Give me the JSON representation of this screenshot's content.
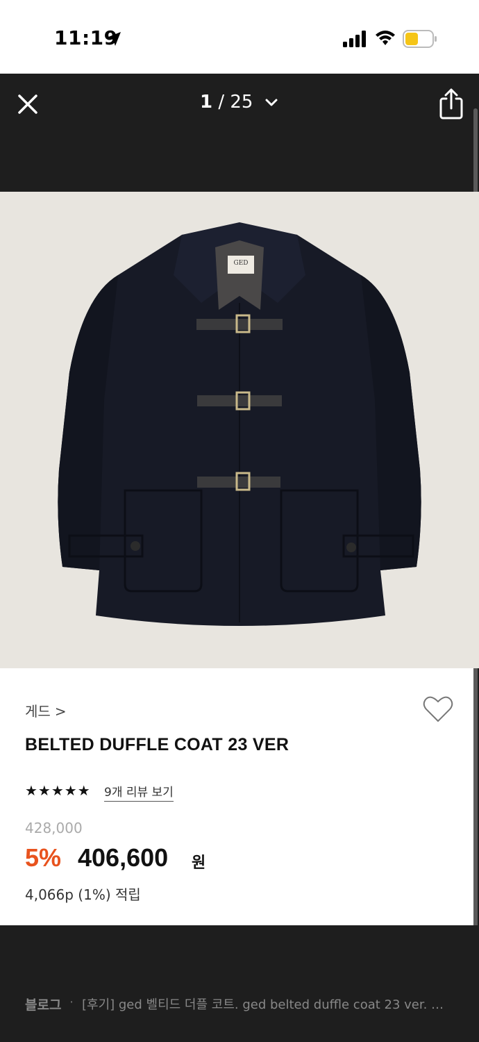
{
  "status_bar": {
    "time": "11:19",
    "icons": [
      "location-arrow-icon",
      "cellular-signal-icon",
      "wifi-icon",
      "battery-low-icon"
    ],
    "battery_color": "#f5c518"
  },
  "viewer": {
    "current": "1",
    "separator": "/",
    "total": "25",
    "close_icon": "close-icon",
    "dropdown_icon": "chevron-down-icon",
    "share_icon": "share-icon"
  },
  "product": {
    "image_label": "GED",
    "brand": "게드",
    "brand_chevron": ">",
    "name": "BELTED DUFFLE COAT 23 VER",
    "stars": "★★★★★",
    "rating": 5,
    "review_link": "9개 리뷰 보기",
    "original_price": "428,000",
    "discount": "5%",
    "sale_price": "406,600",
    "currency": "원",
    "points": "4,066p (1%) 적립",
    "accent_color": "#e8531e"
  },
  "source": {
    "name": "블로그",
    "dot": "·",
    "title": "[후기] ged 벨티드 더플 코트. ged belted duffle coat 23 ver. …"
  }
}
